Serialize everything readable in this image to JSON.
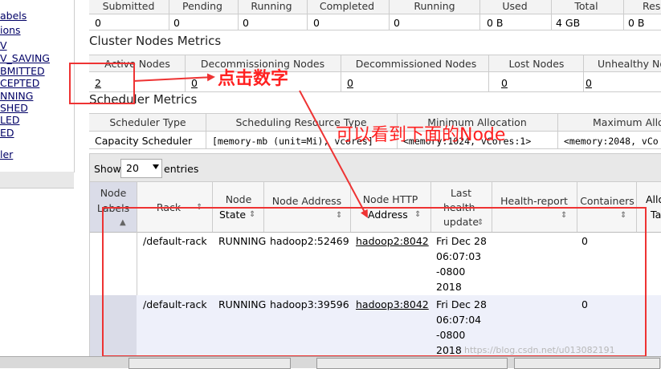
{
  "nav": {
    "links": [
      "abels",
      "ions",
      "V",
      "V_SAVING",
      "BMITTED",
      "CEPTED",
      "NNING",
      "SHED",
      "LED",
      "ED",
      "ler"
    ]
  },
  "top_metrics": {
    "headers": [
      "Submitted",
      "Pending",
      "Running",
      "Completed",
      "Running",
      "Used",
      "Total",
      "Res"
    ],
    "values": [
      "0",
      "0",
      "0",
      "0",
      "0",
      "0 B",
      "4 GB",
      "0 B"
    ]
  },
  "cluster_nodes": {
    "title": "Cluster Nodes Metrics",
    "headers": [
      "Active Nodes",
      "Decommissioning Nodes",
      "Decommissioned Nodes",
      "Lost Nodes",
      "Unhealthy No"
    ],
    "values": [
      "2",
      "0",
      "0",
      "0",
      "0"
    ]
  },
  "scheduler": {
    "title": "Scheduler Metrics",
    "headers": [
      "Scheduler Type",
      "Scheduling Resource Type",
      "Minimum Allocation",
      "Maximum Alloc"
    ],
    "values": [
      "Capacity Scheduler",
      "[memory-mb (unit=Mi), vcores]",
      "<memory:1024, vCores:1>",
      "<memory:2048, vCo"
    ]
  },
  "nodes_table": {
    "show_label": "Show",
    "entries_value": "20",
    "entries_label": "entries",
    "headers": {
      "labels": [
        "Node",
        "Labels"
      ],
      "rack": "Rack",
      "state": [
        "Node",
        "State"
      ],
      "address": "Node Address",
      "http": [
        "Node HTTP",
        "Address"
      ],
      "update": [
        "Last",
        "health-",
        "update"
      ],
      "health": "Health-report",
      "containers": "Containers",
      "alloc": [
        "Allo",
        "Ta"
      ]
    },
    "rows": [
      {
        "rack": "/default-rack",
        "state": "RUNNING",
        "address": "hadoop2:52469",
        "http": "hadoop2:8042",
        "update": [
          "Fri Dec 28",
          "06:07:03",
          "-0800",
          "2018"
        ],
        "containers": "0"
      },
      {
        "rack": "/default-rack",
        "state": "RUNNING",
        "address": "hadoop3:39596",
        "http": "hadoop3:8042",
        "update": [
          "Fri Dec 28",
          "06:07:04",
          "-0800",
          "2018"
        ],
        "containers": "0"
      }
    ]
  },
  "annotations": {
    "click_number": "点击数字",
    "see_node": "可以看到下面的Node",
    "color": "#ff2020"
  },
  "watermark": "https://blog.csdn.net/u013082191"
}
